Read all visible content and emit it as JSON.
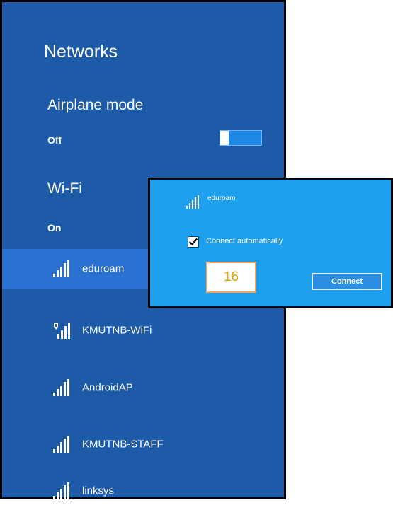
{
  "pane": {
    "title": "Networks",
    "airplane": {
      "label": "Airplane mode",
      "state": "Off"
    },
    "wifi": {
      "label": "Wi-Fi",
      "state": "On"
    },
    "networks": [
      {
        "name": "eduroam",
        "icon": "wifi-signal-icon",
        "selected": true
      },
      {
        "name": "KMUTNB-WiFi",
        "icon": "wifi-secured-signal-icon"
      },
      {
        "name": "AndroidAP",
        "icon": "wifi-signal-icon"
      },
      {
        "name": "KMUTNB-STAFF",
        "icon": "wifi-signal-icon"
      },
      {
        "name": "linksys",
        "icon": "wifi-signal-icon"
      }
    ]
  },
  "popup": {
    "network_name": "eduroam",
    "connect_automatically_label": "Connect automatically",
    "connect_automatically_checked": true,
    "connect_button": "Connect",
    "step_badge": "16"
  },
  "colors": {
    "pane_bg": "#1d5ba8",
    "selected_bg": "#2a71d2",
    "popup_bg": "#1ea0ee",
    "badge_text": "#e2a100"
  }
}
